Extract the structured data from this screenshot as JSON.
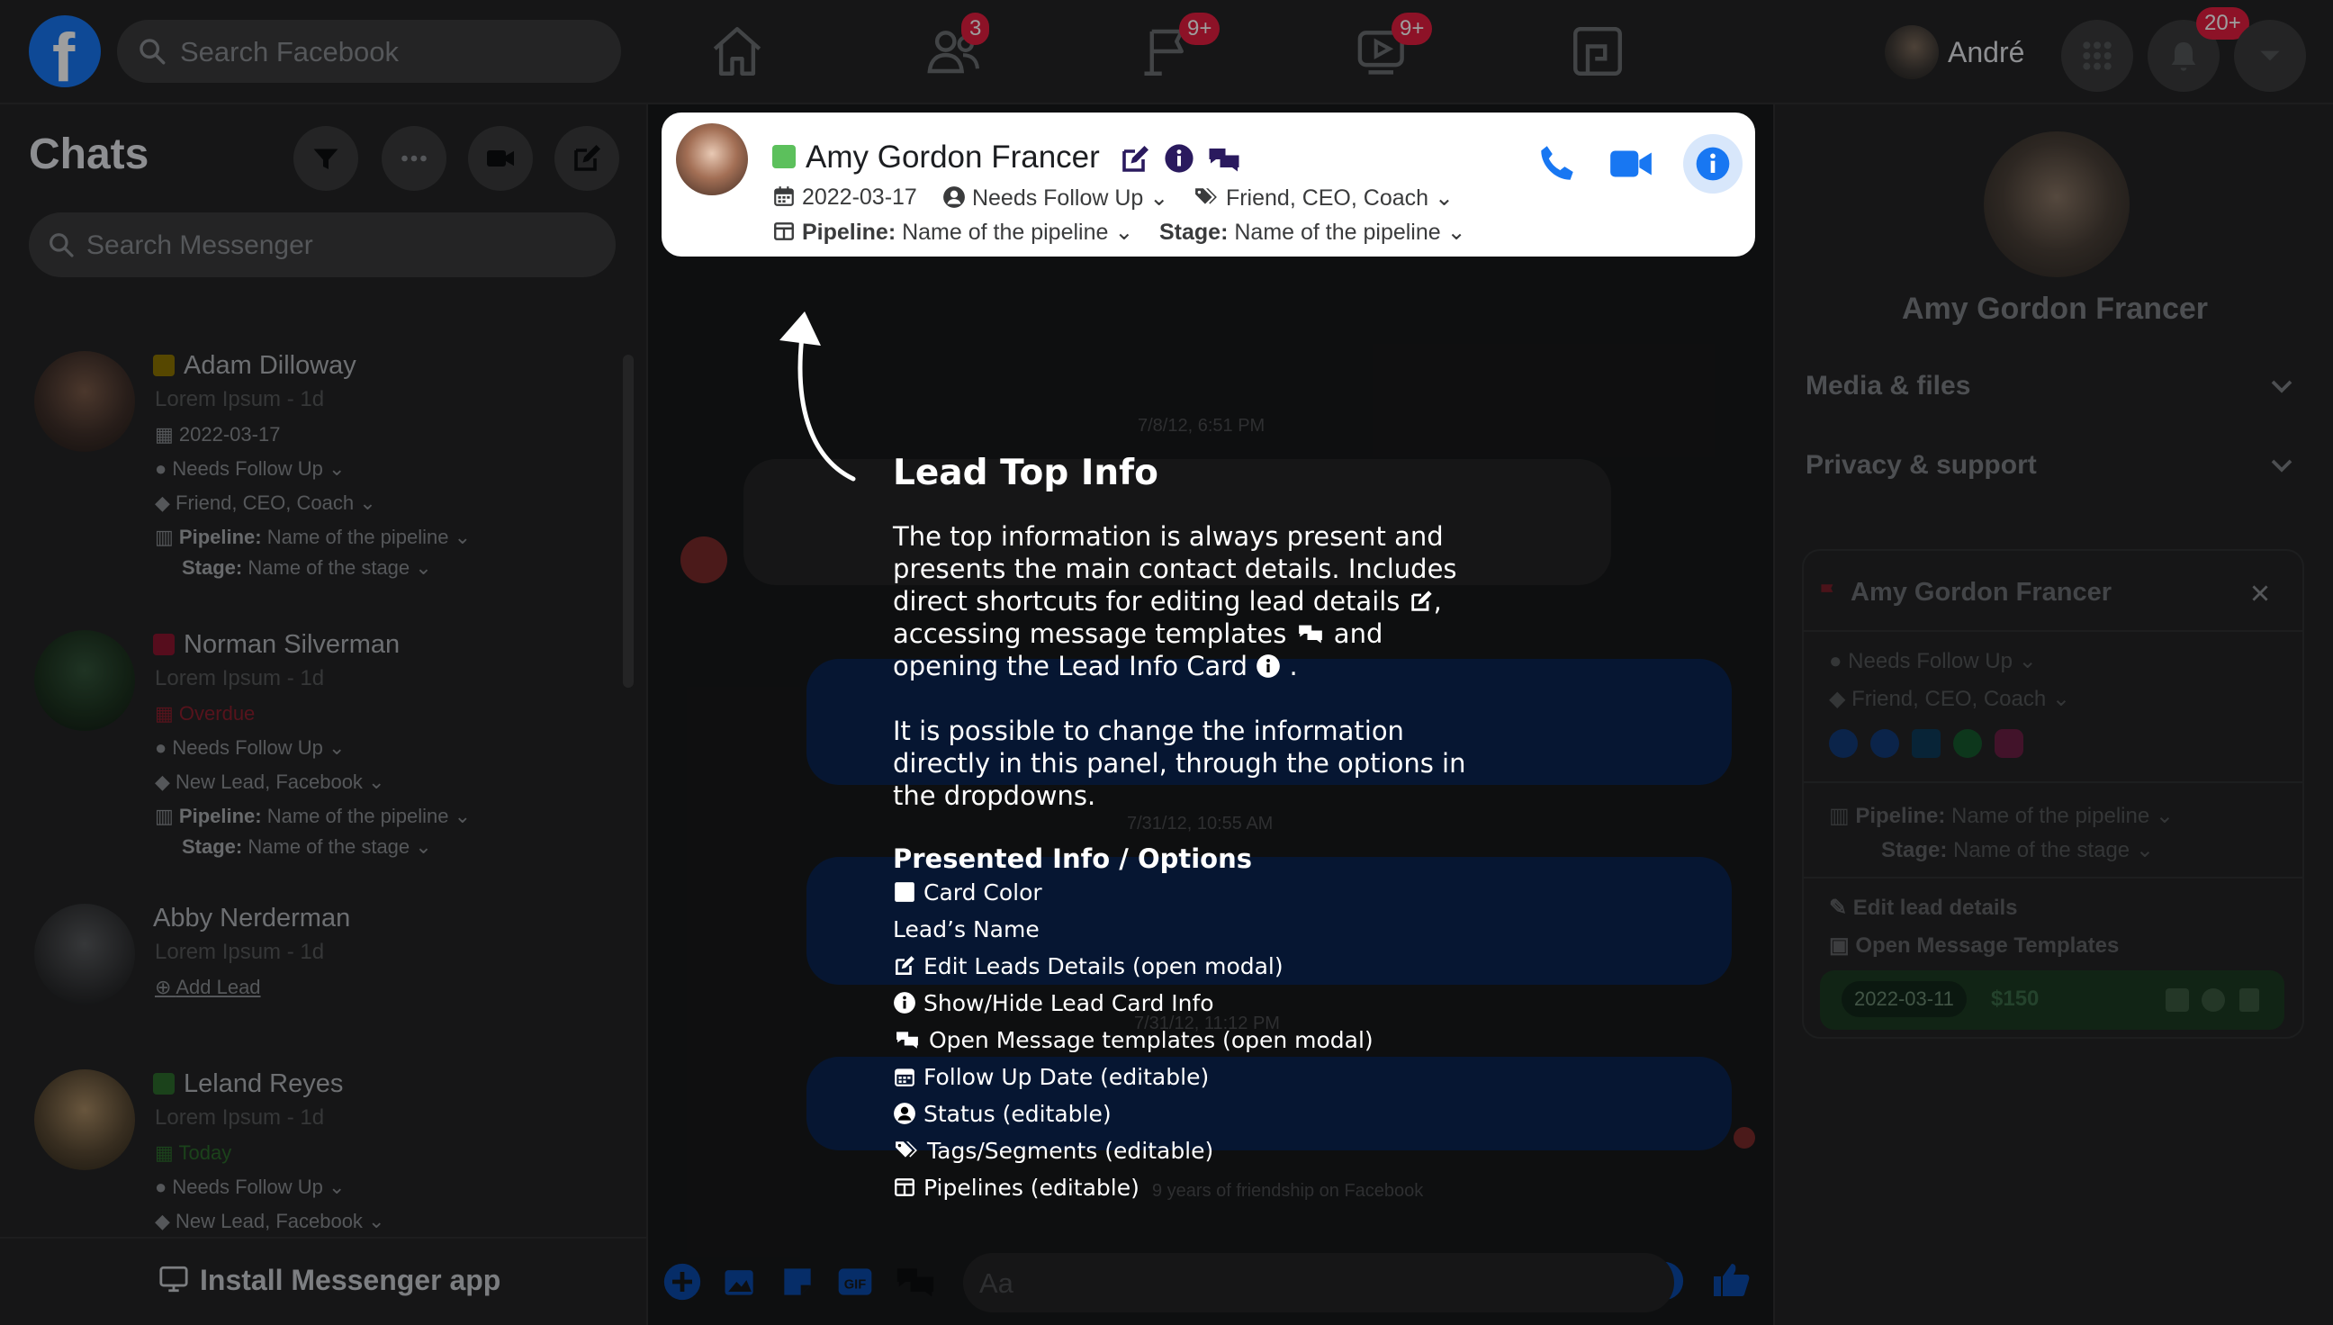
{
  "topbar": {
    "search_placeholder": "Search Facebook",
    "badges": {
      "friends": "3",
      "pages": "9+",
      "watch": "9+",
      "notifications": "20+"
    },
    "profile_name": "André"
  },
  "sidebar": {
    "title": "Chats",
    "search_placeholder": "Search Messenger",
    "install_label": "Install Messenger app",
    "chats": [
      {
        "name": "Adam Dilloway",
        "sub": "Lorem Ipsum - 1d",
        "date": "2022-03-17",
        "status": "Needs Follow Up",
        "tags": "Friend, CEO, Coach",
        "pipeline_label": "Pipeline:",
        "pipeline": "Name of the pipeline",
        "stage_label": "Stage:",
        "stage": "Name of the stage",
        "color": "#c9a400"
      },
      {
        "name": "Norman Silverman",
        "sub": "Lorem Ipsum - 1d",
        "date": "Overdue",
        "status": "Needs Follow Up",
        "tags": "New Lead, Facebook",
        "pipeline_label": "Pipeline:",
        "pipeline": "Name of the pipeline",
        "stage_label": "Stage:",
        "stage": "Name of the stage",
        "color": "#e41e55"
      },
      {
        "name": "Abby Nerderman",
        "sub": "Lorem Ipsum - 1d",
        "add_lead": "Add Lead"
      },
      {
        "name": "Leland Reyes",
        "sub": "Lorem Ipsum - 1d",
        "date": "Today",
        "status": "Needs Follow Up",
        "tags": "New Lead, Facebook",
        "color": "#3fae3f"
      }
    ]
  },
  "header": {
    "name": "Amy Gordon Francer",
    "date": "2022-03-17",
    "status": "Needs Follow Up",
    "tags": "Friend, CEO, Coach",
    "pipeline_label": "Pipeline:",
    "pipeline": "Name of the pipeline",
    "stage_label": "Stage:",
    "stage": "Name of the pipeline",
    "color": "#5cc05c"
  },
  "conversation": {
    "timestamps": [
      "7/8/12, 6:51 PM",
      "7/31/12, 10:55 AM",
      "7/31/12, 11:12 PM"
    ],
    "footer_note": "9 years of friendship on Facebook",
    "composer_placeholder": "Aa"
  },
  "tutorial": {
    "title": "Lead Top Info",
    "body1_a": "The top information is always present and presents the main contact details. Includes direct shortcuts for editing lead details",
    "body1_b": ", accessing message templates",
    "body1_c": " and opening the Lead Info Card",
    "body1_d": " .",
    "body2": "It is possible to change the information directly in this panel, through the options in the dropdowns.",
    "options_title": "Presented Info / Options",
    "options": [
      "Card Color",
      "Lead’s Name",
      "Edit Leads Details (open modal)",
      "Show/Hide Lead Card Info",
      "Open Message templates (open modal)",
      "Follow Up Date (editable)",
      "Status (editable)",
      "Tags/Segments (editable)",
      "Pipelines (editable)"
    ]
  },
  "right_panel": {
    "name": "Amy Gordon Francer",
    "sections": [
      "Media & files",
      "Privacy & support"
    ],
    "lead_card": {
      "name": "Amy Gordon Francer",
      "status": "Needs Follow Up",
      "tags": "Friend, CEO, Coach",
      "pipeline_label": "Pipeline:",
      "pipeline": "Name of the pipeline",
      "stage_label": "Stage:",
      "stage": "Name of the stage",
      "edit_label": "Edit lead details",
      "templates_label": "Open Message Templates",
      "footer_date": "2022-03-11",
      "footer_amount": "$150"
    }
  },
  "colors": {
    "accent": "#1877f2",
    "dark_blue_bubble": "#0b2552"
  }
}
